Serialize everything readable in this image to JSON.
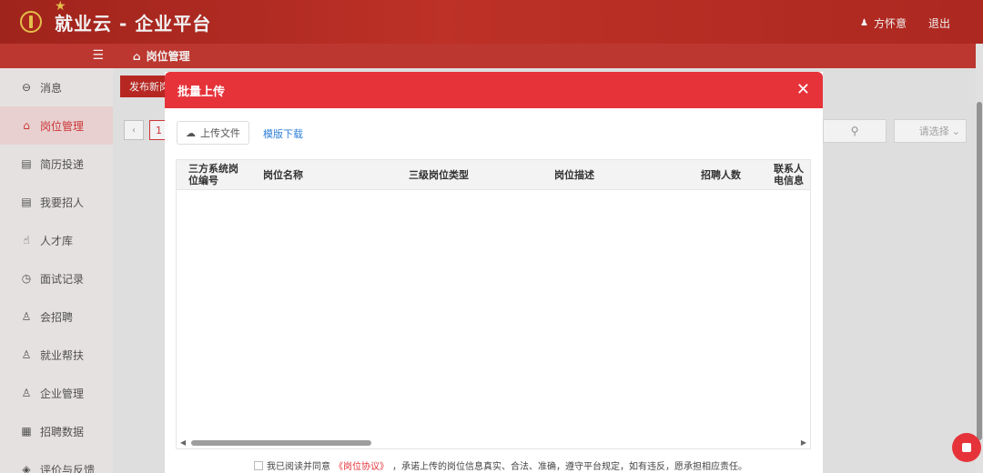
{
  "header": {
    "app_title": "就业云 - 企业平台",
    "user_name": "方怀意",
    "logout": "退出"
  },
  "sidebar": {
    "items": [
      {
        "label": "消息",
        "icon": "message-icon",
        "glyph": "⊖"
      },
      {
        "label": "岗位管理",
        "icon": "home-icon",
        "glyph": "⌂",
        "active": true
      },
      {
        "label": "简历投递",
        "icon": "document-icon",
        "glyph": "▤"
      },
      {
        "label": "我要招人",
        "icon": "document-icon",
        "glyph": "▤"
      },
      {
        "label": "人才库",
        "icon": "thumb-icon",
        "glyph": "☝"
      },
      {
        "label": "面试记录",
        "icon": "clock-icon",
        "glyph": "◷"
      },
      {
        "label": "会招聘",
        "icon": "people-icon",
        "glyph": "♙"
      },
      {
        "label": "就业帮扶",
        "icon": "people-icon",
        "glyph": "♙"
      },
      {
        "label": "企业管理",
        "icon": "people-icon",
        "glyph": "♙"
      },
      {
        "label": "招聘数据",
        "icon": "chart-icon",
        "glyph": "▦"
      },
      {
        "label": "评价与反馈",
        "icon": "feedback-icon",
        "glyph": "◈"
      }
    ]
  },
  "content": {
    "breadcrumb": "岗位管理",
    "publish_button": "发布新岗",
    "page_number": "1",
    "select_placeholder": "请选择"
  },
  "modal": {
    "title": "批量上传",
    "upload_button": "上传文件",
    "template_link": "模版下载",
    "columns": [
      "三方系统岗位编号",
      "岗位名称",
      "三级岗位类型",
      "岗位描述",
      "招聘人数",
      "联系人电信息"
    ],
    "agree_prefix": "我已阅读并同意",
    "agreement_link": "《岗位协议》",
    "agree_suffix": "，承诺上传的岗位信息真实、合法、准确，遵守平台规定，如有违反，愿承担相应责任。"
  },
  "colors": {
    "primary": "#e6333a",
    "header": "#b62b22",
    "link": "#2f7fd8"
  }
}
